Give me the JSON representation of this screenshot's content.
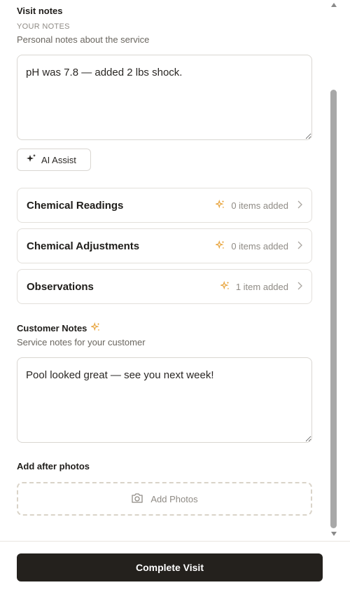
{
  "visit_notes": {
    "title": "Visit notes",
    "overline": "YOUR NOTES",
    "subtitle": "Personal notes about the service",
    "value": "pH was 7.8 — added 2 lbs shock."
  },
  "ai_assist": {
    "label": "AI Assist"
  },
  "sections": [
    {
      "label": "Chemical Readings",
      "count_text": "0 items added"
    },
    {
      "label": "Chemical Adjustments",
      "count_text": "0 items added"
    },
    {
      "label": "Observations",
      "count_text": "1 item added"
    }
  ],
  "customer_notes": {
    "title": "Customer Notes",
    "subtitle": "Service notes for your customer",
    "value": "Pool looked great — see you next week!"
  },
  "photos": {
    "title": "Add after photos",
    "button_label": "Add Photos"
  },
  "footer": {
    "complete_label": "Complete Visit"
  },
  "colors": {
    "accent": "#e8a33a",
    "primary_button": "#24211d"
  }
}
